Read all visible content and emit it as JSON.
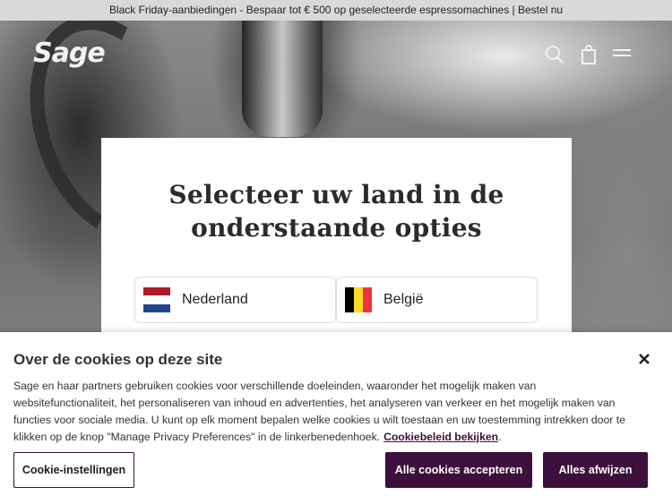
{
  "promo": {
    "text": "Black Friday-aanbiedingen - Bespaar tot € 500 op geselecteerde espressomachines | Bestel nu"
  },
  "header": {
    "logo": "Sage",
    "icons": [
      "search-icon",
      "shopping-bag-icon",
      "menu-icon"
    ]
  },
  "country_modal": {
    "title": "Selecteer uw land in de onderstaande opties",
    "countries": [
      {
        "label": "Nederland",
        "flag": "nl-flag-icon",
        "colors": [
          "#ae1c28",
          "#ffffff",
          "#21468b"
        ]
      },
      {
        "label": "België",
        "flag": "be-flag-icon",
        "colors": [
          "#000000",
          "#fdda24",
          "#ef3340"
        ]
      }
    ]
  },
  "cookie_banner": {
    "title": "Over de cookies op deze site",
    "body": "Sage en haar partners gebruiken cookies voor verschillende doeleinden, waaronder het mogelijk maken van websitefunctionaliteit, het personaliseren van inhoud en advertenties, het analyseren van verkeer en het mogelijk maken van functies voor sociale media. U kunt op elk moment bepalen welke cookies u wilt toestaan en uw toestemming intrekken door te klikken op de knop \"Manage Privacy Preferences\" in de linkerbenedenhoek.",
    "policy_link": "Cookiebeleid bekijken",
    "settings_button": "Cookie-instellingen",
    "accept_button": "Alle cookies accepteren",
    "reject_button": "Alles afwijzen",
    "accent_color": "#3c0f3c"
  }
}
